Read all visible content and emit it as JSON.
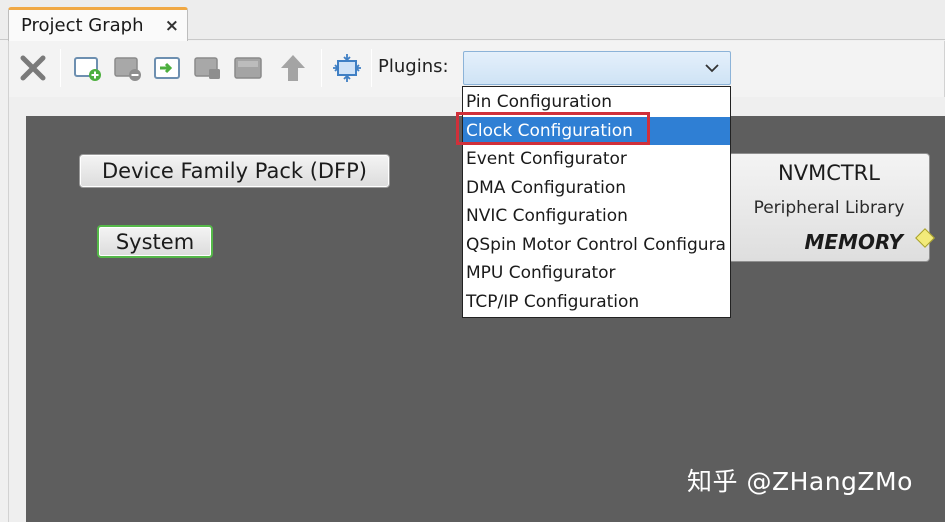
{
  "tab": {
    "title": "Project Graph",
    "close": "×"
  },
  "toolbar": {
    "icons": [
      "delete-icon",
      "add-component-icon",
      "remove-component-icon",
      "import-icon",
      "export-icon",
      "save-icon",
      "up-arrow-icon",
      "fit-view-icon"
    ],
    "plugins_label": "Plugins:",
    "plugins_value": ""
  },
  "plugins_menu": {
    "items": [
      "Pin Configuration",
      "Clock Configuration",
      "Event Configurator",
      "DMA Configuration",
      "NVIC Configuration",
      "QSpin Motor Control Configura",
      "MPU Configurator",
      "TCP/IP Configuration"
    ],
    "selected_index": 1
  },
  "graph": {
    "dfp_label": "Device Family Pack (DFP)",
    "system_label": "System",
    "nvm": {
      "title": "NVMCTRL",
      "subtitle": "Peripheral Library",
      "category": "MEMORY"
    }
  },
  "watermark": "知乎 @ZHangZMo",
  "colors": {
    "tab_accent": "#f0a844",
    "canvas_bg": "#5e5e5e",
    "selection": "#2f7fd4",
    "highlight_box": "#d0303a",
    "system_border": "#55b849"
  }
}
